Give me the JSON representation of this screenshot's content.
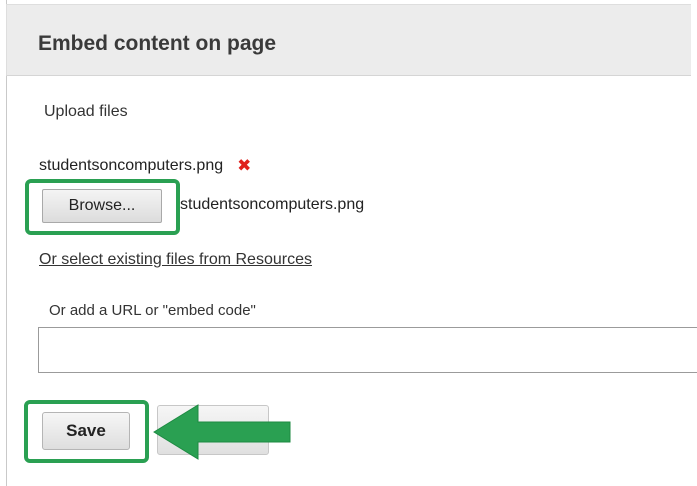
{
  "header": {
    "title": "Embed content on page"
  },
  "upload": {
    "label": "Upload files",
    "file_name": "studentsoncomputers.png",
    "remove_icon": "✖",
    "browse_label": "Browse...",
    "chosen_file": "studentsoncomputers.png"
  },
  "resources": {
    "link_text": "Or select existing files from Resources"
  },
  "url": {
    "label": "Or add a URL or \"embed code\"",
    "value": "",
    "placeholder": ""
  },
  "actions": {
    "save_label": "Save",
    "cancel_label": "Cancel"
  },
  "annotations": {
    "highlight_color": "#2aa052",
    "arrow_icon": "left-arrow-icon"
  }
}
